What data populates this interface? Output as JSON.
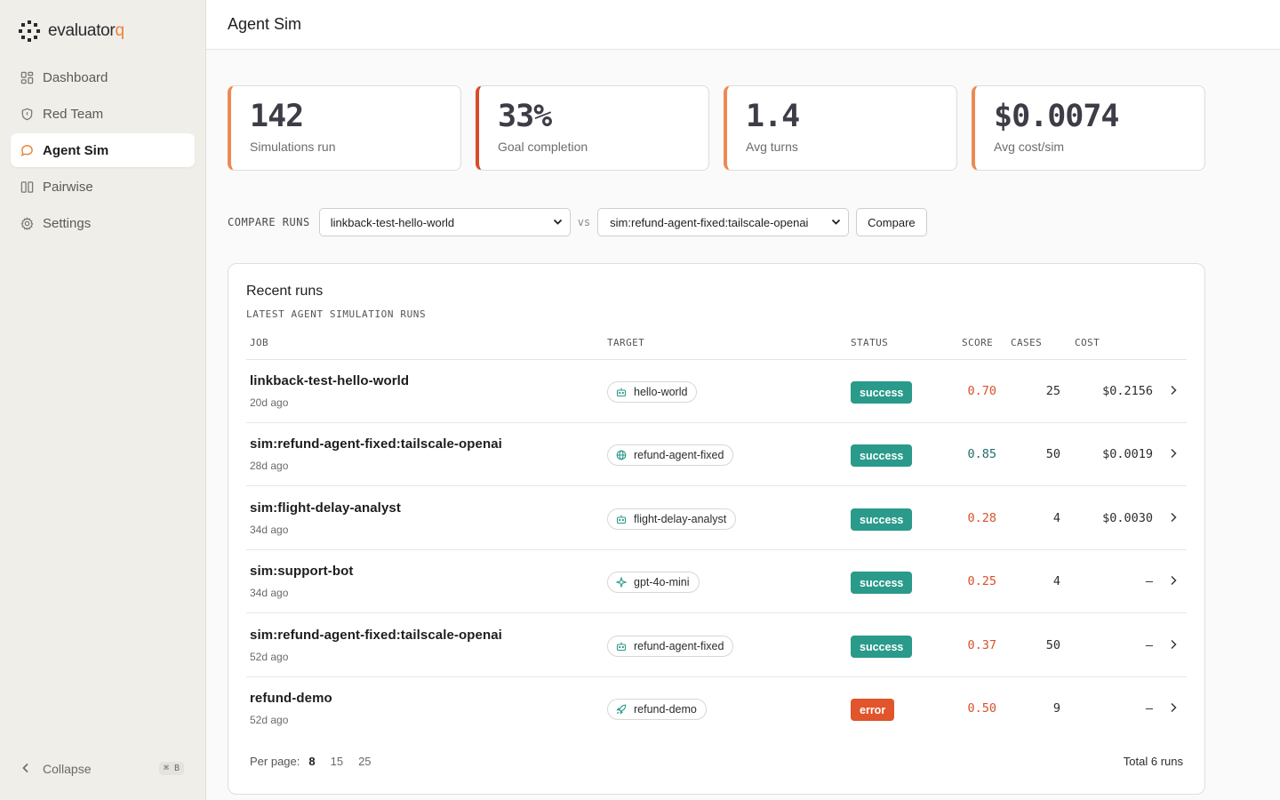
{
  "brand": {
    "name_main": "evaluator",
    "name_accent": "q"
  },
  "sidebar": {
    "items": [
      {
        "label": "Dashboard",
        "icon": "dashboard-icon",
        "active": false
      },
      {
        "label": "Red Team",
        "icon": "shield-icon",
        "active": false
      },
      {
        "label": "Agent Sim",
        "icon": "chat-bubble-icon",
        "active": true
      },
      {
        "label": "Pairwise",
        "icon": "columns-icon",
        "active": false
      },
      {
        "label": "Settings",
        "icon": "gear-icon",
        "active": false
      }
    ],
    "collapse_label": "Collapse",
    "collapse_shortcut": "⌘ B"
  },
  "header": {
    "title": "Agent Sim"
  },
  "stats": [
    {
      "value": "142",
      "label": "Simulations run"
    },
    {
      "value": "33%",
      "label": "Goal completion"
    },
    {
      "value": "1.4",
      "label": "Avg turns"
    },
    {
      "value": "$0.0074",
      "label": "Avg cost/sim"
    }
  ],
  "compare": {
    "label": "COMPARE RUNS",
    "left_selected": "linkback-test-hello-world",
    "vs": "vs",
    "right_selected": "sim:refund-agent-fixed:tailscale-openai",
    "button": "Compare"
  },
  "runs": {
    "title": "Recent runs",
    "subtitle": "LATEST AGENT SIMULATION RUNS",
    "columns": {
      "job": "JOB",
      "target": "TARGET",
      "status": "STATUS",
      "score": "SCORE",
      "cases": "CASES",
      "cost": "COST"
    },
    "rows": [
      {
        "job": "linkback-test-hello-world",
        "time": "20d ago",
        "target": "hello-world",
        "target_icon": "bot-icon",
        "status": "success",
        "score": "0.70",
        "cases": "25",
        "cost": "$0.2156"
      },
      {
        "job": "sim:refund-agent-fixed:tailscale-openai",
        "time": "28d ago",
        "target": "refund-agent-fixed",
        "target_icon": "globe-icon",
        "status": "success",
        "score": "0.85",
        "cases": "50",
        "cost": "$0.0019"
      },
      {
        "job": "sim:flight-delay-analyst",
        "time": "34d ago",
        "target": "flight-delay-analyst",
        "target_icon": "bot-icon",
        "status": "success",
        "score": "0.28",
        "cases": "4",
        "cost": "$0.0030"
      },
      {
        "job": "sim:support-bot",
        "time": "34d ago",
        "target": "gpt-4o-mini",
        "target_icon": "sparkle-icon",
        "status": "success",
        "score": "0.25",
        "cases": "4",
        "cost": "—"
      },
      {
        "job": "sim:refund-agent-fixed:tailscale-openai",
        "time": "52d ago",
        "target": "refund-agent-fixed",
        "target_icon": "bot-icon",
        "status": "success",
        "score": "0.37",
        "cases": "50",
        "cost": "—"
      },
      {
        "job": "refund-demo",
        "time": "52d ago",
        "target": "refund-demo",
        "target_icon": "rocket-icon",
        "status": "error",
        "score": "0.50",
        "cases": "9",
        "cost": "—"
      }
    ],
    "per_page_label": "Per page:",
    "per_page_options": [
      "8",
      "15",
      "25"
    ],
    "per_page_selected": "8",
    "total": "Total 6 runs"
  },
  "colors": {
    "accent": "#ee8a4f",
    "success": "#2a9a8a",
    "error": "#e0552b",
    "score_low": "#d9502a",
    "score_high": "#1f6e6a"
  }
}
